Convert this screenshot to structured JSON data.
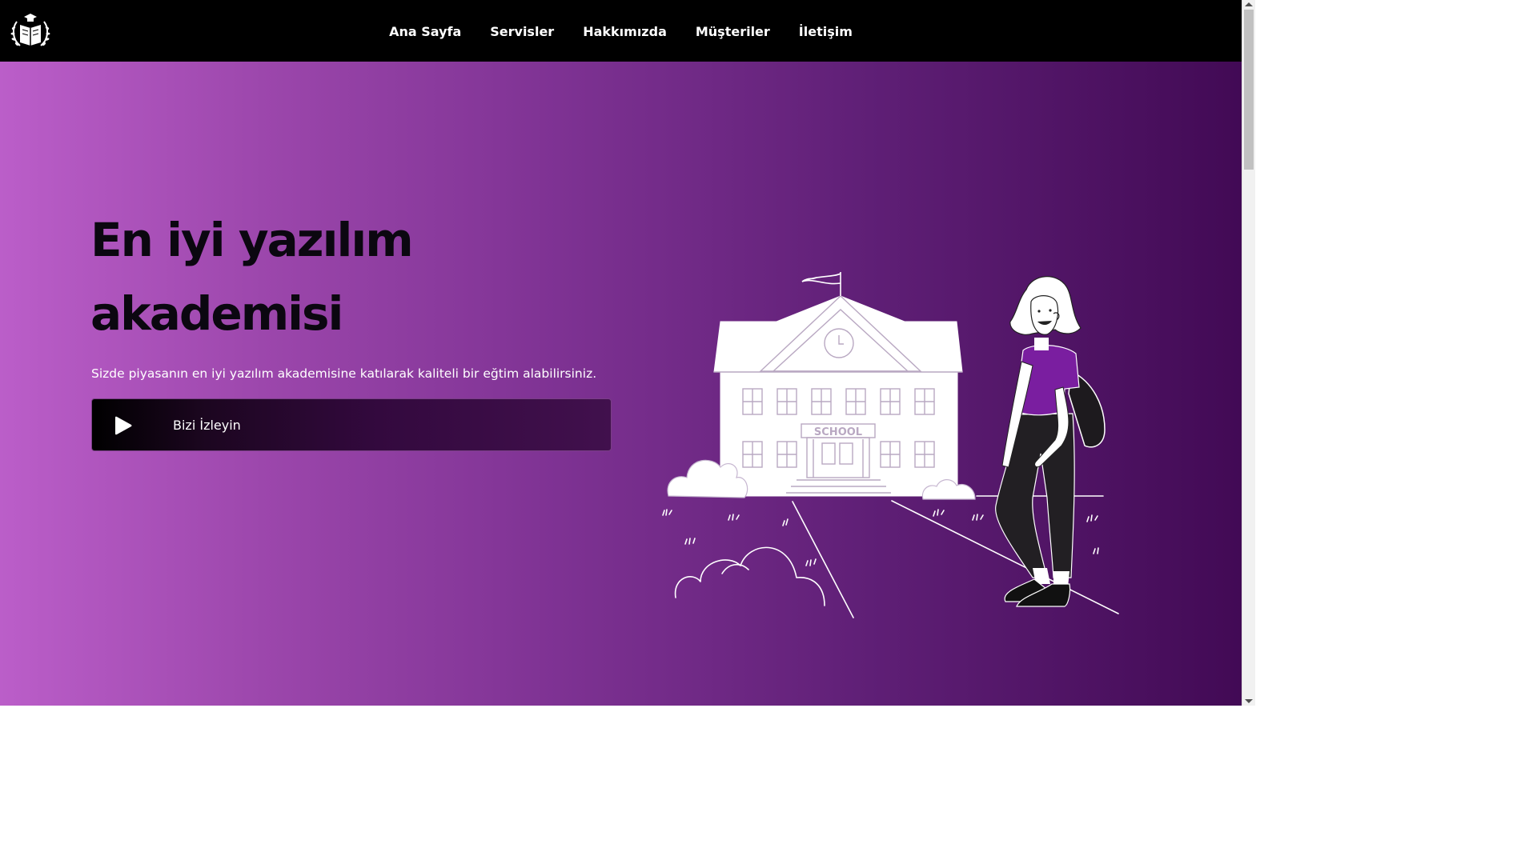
{
  "nav": {
    "items": [
      {
        "label": "Ana Sayfa"
      },
      {
        "label": "Servisler"
      },
      {
        "label": "Hakkımızda"
      },
      {
        "label": "Müşteriler"
      },
      {
        "label": "İletişim"
      }
    ]
  },
  "hero": {
    "title": "En iyi yazılım akademisi",
    "subtitle": "Sizde piyasanın en iyi yazılım akademisine katılarak kaliteli bir eğtim alabilirsiniz.",
    "watch_label": "Bizi İzleyin"
  },
  "illustration": {
    "school_sign": "SCHOOL"
  },
  "colors": {
    "navbar": "#000000",
    "gradient_start": "#bb5ec9",
    "gradient_end": "#420a55",
    "title_text": "#0b0710"
  },
  "icons": [
    "logo-icon",
    "play-icon"
  ]
}
